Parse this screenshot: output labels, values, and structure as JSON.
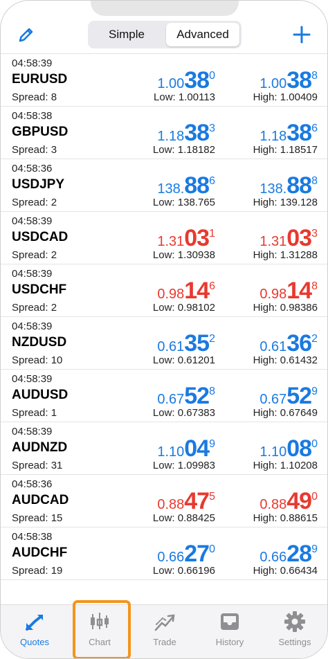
{
  "header": {
    "edit_icon": "pencil-icon",
    "add_icon": "plus-icon",
    "segments": {
      "simple": "Simple",
      "advanced": "Advanced",
      "selected": "advanced"
    }
  },
  "labels": {
    "low": "Low: ",
    "high": "High: ",
    "spread": "Spread: "
  },
  "colors": {
    "up": "#1a7ae0",
    "down": "#e8392f",
    "highlight": "#f3951b"
  },
  "quotes": [
    {
      "time": "04:58:39",
      "symbol": "EURUSD",
      "spread": "8",
      "direction": "up",
      "bid": {
        "small": "1.00",
        "big": "38",
        "sup": "0"
      },
      "ask": {
        "small": "1.00",
        "big": "38",
        "sup": "8"
      },
      "low": "1.00113",
      "high": "1.00409"
    },
    {
      "time": "04:58:38",
      "symbol": "GBPUSD",
      "spread": "3",
      "direction": "up",
      "bid": {
        "small": "1.18",
        "big": "38",
        "sup": "3"
      },
      "ask": {
        "small": "1.18",
        "big": "38",
        "sup": "6"
      },
      "low": "1.18182",
      "high": "1.18517"
    },
    {
      "time": "04:58:36",
      "symbol": "USDJPY",
      "spread": "2",
      "direction": "up",
      "bid": {
        "small": "138.",
        "big": "88",
        "sup": "6"
      },
      "ask": {
        "small": "138.",
        "big": "88",
        "sup": "8"
      },
      "low": "138.765",
      "high": "139.128"
    },
    {
      "time": "04:58:39",
      "symbol": "USDCAD",
      "spread": "2",
      "direction": "down",
      "bid": {
        "small": "1.31",
        "big": "03",
        "sup": "1"
      },
      "ask": {
        "small": "1.31",
        "big": "03",
        "sup": "3"
      },
      "low": "1.30938",
      "high": "1.31288"
    },
    {
      "time": "04:58:39",
      "symbol": "USDCHF",
      "spread": "2",
      "direction": "down",
      "bid": {
        "small": "0.98",
        "big": "14",
        "sup": "6"
      },
      "ask": {
        "small": "0.98",
        "big": "14",
        "sup": "8"
      },
      "low": "0.98102",
      "high": "0.98386"
    },
    {
      "time": "04:58:39",
      "symbol": "NZDUSD",
      "spread": "10",
      "direction": "up",
      "bid": {
        "small": "0.61",
        "big": "35",
        "sup": "2"
      },
      "ask": {
        "small": "0.61",
        "big": "36",
        "sup": "2"
      },
      "low": "0.61201",
      "high": "0.61432"
    },
    {
      "time": "04:58:39",
      "symbol": "AUDUSD",
      "spread": "1",
      "direction": "up",
      "bid": {
        "small": "0.67",
        "big": "52",
        "sup": "8"
      },
      "ask": {
        "small": "0.67",
        "big": "52",
        "sup": "9"
      },
      "low": "0.67383",
      "high": "0.67649"
    },
    {
      "time": "04:58:39",
      "symbol": "AUDNZD",
      "spread": "31",
      "direction": "up",
      "bid": {
        "small": "1.10",
        "big": "04",
        "sup": "9"
      },
      "ask": {
        "small": "1.10",
        "big": "08",
        "sup": "0"
      },
      "low": "1.09983",
      "high": "1.10208"
    },
    {
      "time": "04:58:36",
      "symbol": "AUDCAD",
      "spread": "15",
      "direction": "down",
      "bid": {
        "small": "0.88",
        "big": "47",
        "sup": "5"
      },
      "ask": {
        "small": "0.88",
        "big": "49",
        "sup": "0"
      },
      "low": "0.88425",
      "high": "0.88615"
    },
    {
      "time": "04:58:38",
      "symbol": "AUDCHF",
      "spread": "19",
      "direction": "up",
      "bid": {
        "small": "0.66",
        "big": "27",
        "sup": "0"
      },
      "ask": {
        "small": "0.66",
        "big": "28",
        "sup": "9"
      },
      "low": "0.66196",
      "high": "0.66434"
    }
  ],
  "tabs": [
    {
      "id": "quotes",
      "label": "Quotes",
      "icon": "quotes-arrows-icon",
      "active": true
    },
    {
      "id": "chart",
      "label": "Chart",
      "icon": "candlestick-chart-icon",
      "active": false,
      "highlighted": true
    },
    {
      "id": "trade",
      "label": "Trade",
      "icon": "trade-line-icon",
      "active": false
    },
    {
      "id": "history",
      "label": "History",
      "icon": "inbox-icon",
      "active": false
    },
    {
      "id": "settings",
      "label": "Settings",
      "icon": "gear-icon",
      "active": false
    }
  ]
}
